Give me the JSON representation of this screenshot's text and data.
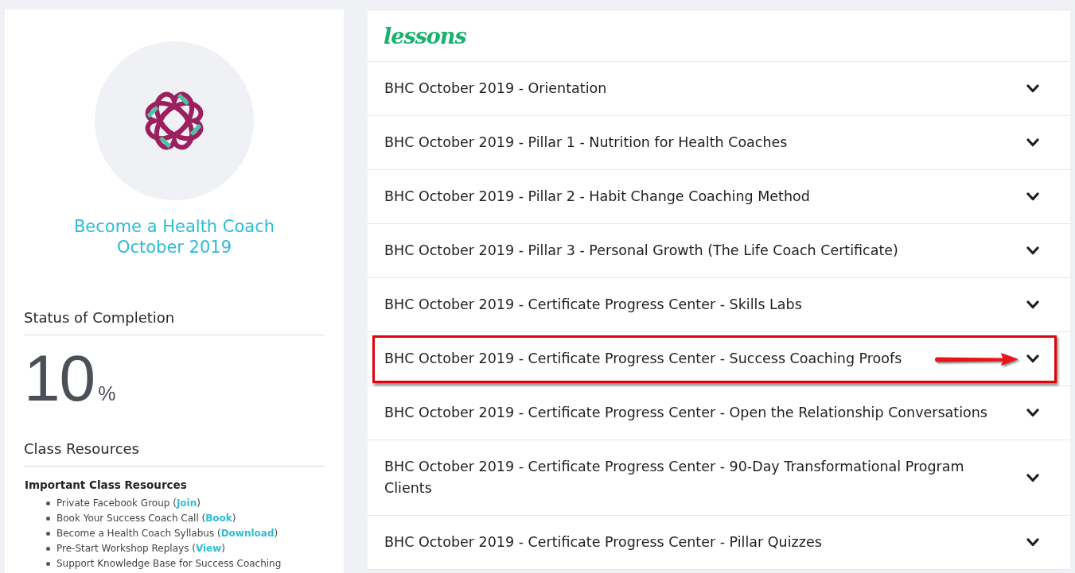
{
  "course": {
    "title": "Become a Health Coach October 2019"
  },
  "completion": {
    "heading": "Status of Completion",
    "value": "10",
    "unit": "%"
  },
  "resources": {
    "heading": "Class Resources",
    "subheading": "Important Class Resources",
    "items": [
      {
        "text": "Private Facebook Group (",
        "link": "Join",
        "after": ")"
      },
      {
        "text": "Book Your Success Coach Call (",
        "link": "Book",
        "after": ")"
      },
      {
        "text": "Become a Health Coach Syllabus (",
        "link": "Download",
        "after": ")"
      },
      {
        "text": "Pre-Start Workshop Replays (",
        "link": "View",
        "after": ")"
      },
      {
        "text": "Support Knowledge Base for Success Coaching"
      }
    ]
  },
  "lessons": {
    "heading": "lessons",
    "items": [
      {
        "title": "BHC October 2019 - Orientation",
        "expanded": false,
        "highlighted": false
      },
      {
        "title": "BHC October 2019 - Pillar 1 - Nutrition for Health Coaches",
        "expanded": false,
        "highlighted": false
      },
      {
        "title": "BHC October 2019 - Pillar 2 - Habit Change Coaching Method",
        "expanded": false,
        "highlighted": false
      },
      {
        "title": "BHC October 2019 - Pillar 3 - Personal Growth (The Life Coach Certificate)",
        "expanded": false,
        "highlighted": false
      },
      {
        "title": "BHC October 2019 - Certificate Progress Center - Skills Labs",
        "expanded": false,
        "highlighted": false
      },
      {
        "title": "BHC October 2019 - Certificate Progress Center - Success Coaching Proofs",
        "expanded": false,
        "highlighted": true
      },
      {
        "title": "BHC October 2019 - Certificate Progress Center - Open the Relationship Conversations",
        "expanded": false,
        "highlighted": false
      },
      {
        "title": "BHC October 2019 - Certificate Progress Center - 90-Day Transformational Program Clients",
        "expanded": false,
        "highlighted": false
      },
      {
        "title": "BHC October 2019 - Certificate Progress Center - Pillar Quizzes",
        "expanded": false,
        "highlighted": false
      }
    ]
  }
}
